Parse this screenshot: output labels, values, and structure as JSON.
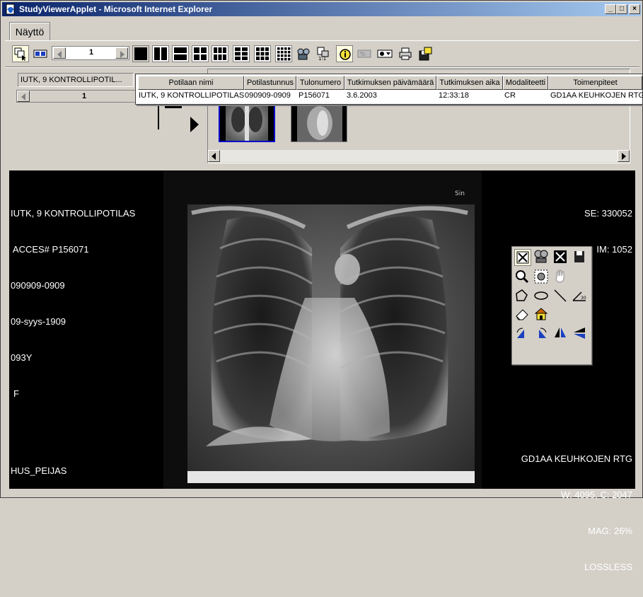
{
  "window": {
    "title": "StudyViewerApplet - Microsoft Internet Explorer",
    "buttons": {
      "minimize": "_",
      "maximize": "□",
      "close": "×"
    }
  },
  "tab": {
    "label": "Näyttö"
  },
  "toolbar": {
    "page_spinner_value": "1",
    "icons": [
      "select-series-icon",
      "compare-icon",
      "layout-1x1-icon",
      "layout-1x2-icon",
      "layout-2x1-icon",
      "layout-2x2-icon",
      "layout-2x3-icon",
      "layout-3x2-icon",
      "layout-3x3-icon",
      "layout-4x4-icon",
      "cine-icon",
      "scale-1to1-icon",
      "info-icon",
      "invert-icon",
      "window-preset-icon",
      "print-icon",
      "save-icon"
    ]
  },
  "study": {
    "patient_field": "IUTK, 9 KONTROLLIPOTIL...",
    "series_spinner_value": "1"
  },
  "study_list": {
    "columns": [
      "Potilaan nimi",
      "Potilastunnus",
      "Tulonumero",
      "Tutkimuksen päivämäärä",
      "Tutkimuksen aika",
      "Modaliteetti",
      "Toimenpiteet"
    ],
    "rows": [
      [
        "IUTK, 9 KONTROLLIPOTILAS",
        "090909-0909",
        "P156071",
        "3.6.2003",
        "12:33:18",
        "CR",
        "GD1AA KEUHKOJEN RTG"
      ]
    ]
  },
  "thumbnails": [
    "chest-pa-thumbnail",
    "chest-lateral-thumbnail"
  ],
  "viewer": {
    "top_left": [
      "IUTK, 9 KONTROLLIPOTILAS",
      " ACCES# P156071",
      "090909-0909",
      "09-syys-1909",
      "093Y",
      "F"
    ],
    "top_right": [
      "SE: 330052",
      "IM: 1052"
    ],
    "bottom_left": "HUS_PEIJAS",
    "bottom_right": [
      "GD1AA KEUHKOJEN RTG",
      "W: 4095, C: 2047",
      "MAG: 26%",
      "LOSSLESS"
    ],
    "image_marker": "Sin"
  },
  "tool_palette": {
    "tools": [
      "fit-icon",
      "sync-icon",
      "fullscreen-icon",
      "save-image-icon",
      "zoom-icon",
      "magnify-region-icon",
      "pan-hand-icon",
      "polygon-roi-icon",
      "ellipse-roi-icon",
      "line-measure-icon",
      "angle-measure-icon",
      "eraser-icon",
      "reset-icon",
      "rotate-left-icon",
      "rotate-right-icon",
      "flip-horizontal-icon",
      "flip-vertical-icon"
    ]
  },
  "colors": {
    "titlebar_start": "#0a246a",
    "titlebar_end": "#a6caf0",
    "face": "#d4d0c8",
    "selection": "#0000cc",
    "highlight": "#fffde0"
  }
}
